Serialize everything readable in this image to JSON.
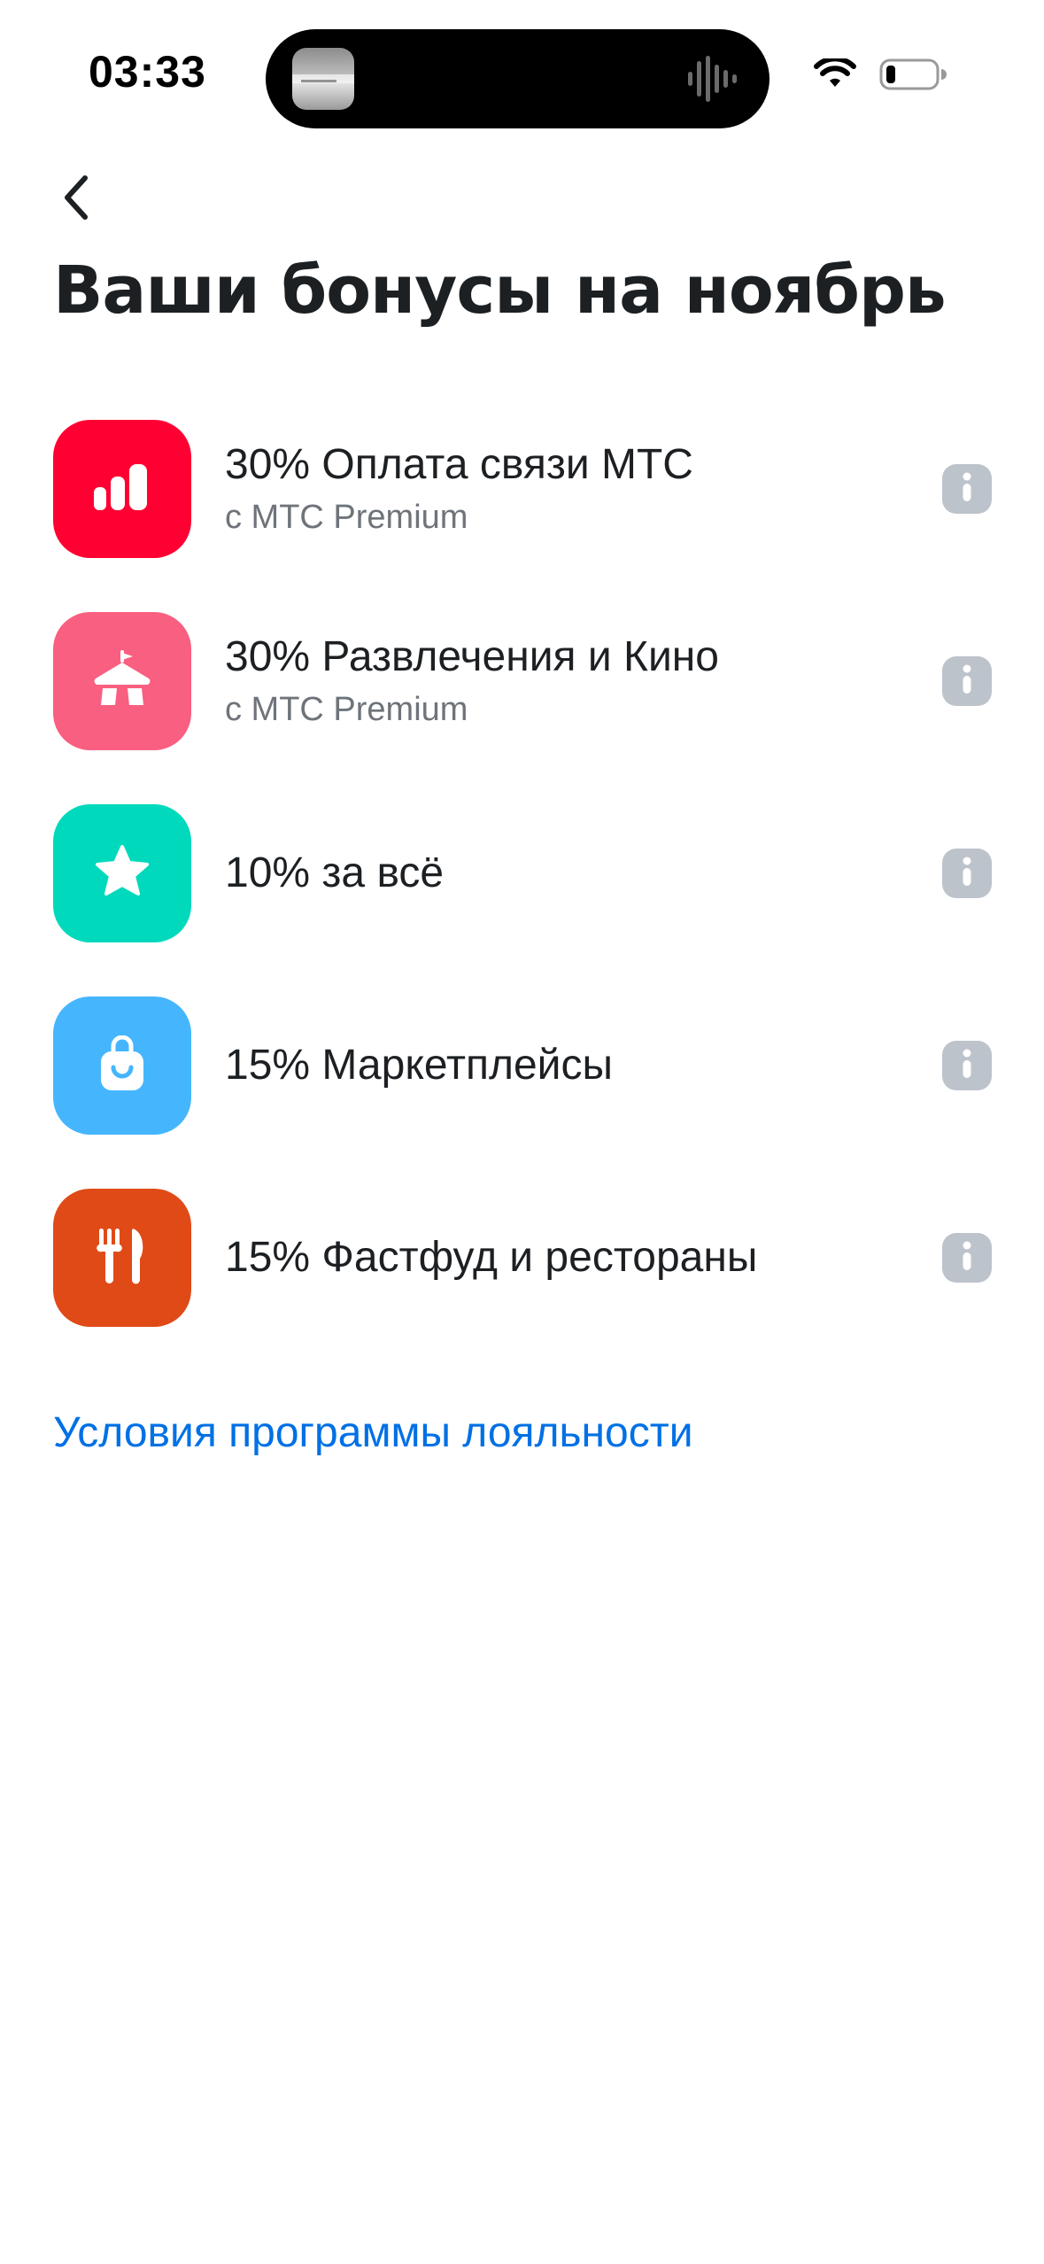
{
  "status_bar": {
    "time": "03:33",
    "icons": [
      "wifi-icon",
      "battery-icon"
    ]
  },
  "header": {
    "back_icon": "chevron-left-icon",
    "title": "Ваши бонусы на ноябрь"
  },
  "bonuses": [
    {
      "title": "30% Оплата связи МТС",
      "subtitle": "с МТС Premium",
      "icon": "signal-bars-icon",
      "color": "#ff0032"
    },
    {
      "title": "30% Развлечения и Кино",
      "subtitle": "с МТС Premium",
      "icon": "circus-tent-icon",
      "color": "#f95f80"
    },
    {
      "title": "10% за всё",
      "subtitle": "",
      "icon": "star-icon",
      "color": "#00d9bc"
    },
    {
      "title": "15% Маркетплейсы",
      "subtitle": "",
      "icon": "shopping-bag-icon",
      "color": "#45b6fe"
    },
    {
      "title": "15% Фастфуд и рестораны",
      "subtitle": "",
      "icon": "fork-knife-icon",
      "color": "#e04a17"
    }
  ],
  "info_icon": "info-icon",
  "loyalty_link": "Условия программы лояльности",
  "colors": {
    "link": "#0070e5",
    "text": "#1d2023",
    "subtitle": "#6e747a",
    "info_badge": "#bcc3cb"
  }
}
